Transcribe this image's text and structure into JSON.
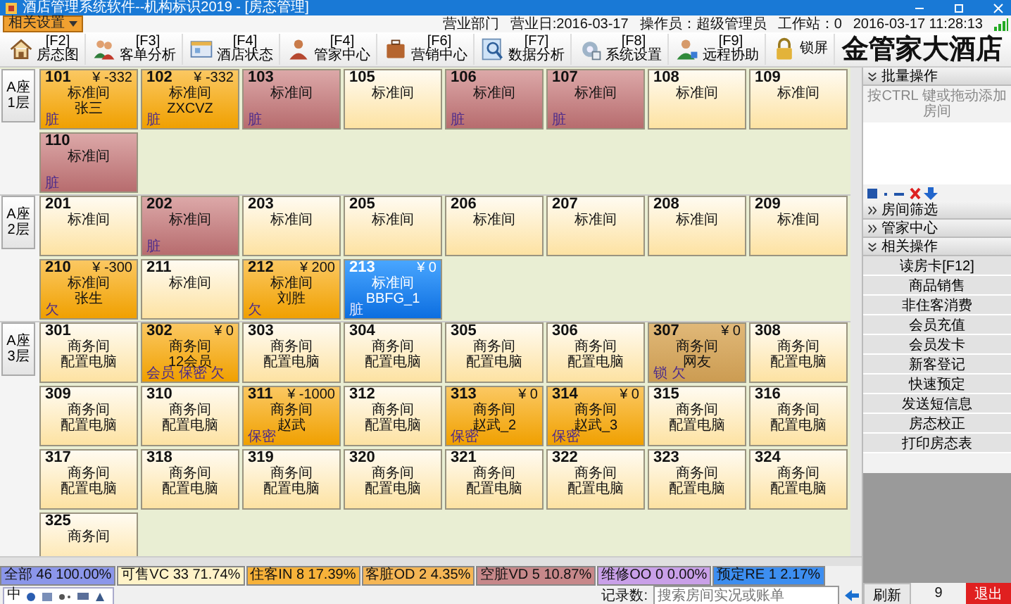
{
  "window": {
    "title": "酒店管理系统软件--机构标识2019 - [房态管理]"
  },
  "menu": {
    "label": "相关设置"
  },
  "header_info": [
    "营业部门",
    "营业日:2016-03-17",
    "操作员：超级管理员",
    "工作站：0",
    "2016-03-17 11:28:13"
  ],
  "toolbar": [
    {
      "key": "[F2]",
      "label": "房态图"
    },
    {
      "key": "[F3]",
      "label": "客单分析"
    },
    {
      "key": "[F4]",
      "label": "酒店状态"
    },
    {
      "key": "[F4]",
      "label": "管家中心"
    },
    {
      "key": "[F6]",
      "label": "营销中心"
    },
    {
      "key": "[F7]",
      "label": "数据分析"
    },
    {
      "key": "[F8]",
      "label": "系统设置"
    },
    {
      "key": "[F9]",
      "label": "远程协助"
    },
    {
      "label": "锁屏"
    }
  ],
  "logo": "金管家大酒店",
  "floors": [
    {
      "label": "A座 1层",
      "rows": [
        [
          {
            "number": "101",
            "price": "¥ -332",
            "type": "标准间",
            "detail": "张三",
            "tag": "脏",
            "kind": "occupied"
          },
          {
            "number": "102",
            "price": "¥ -332",
            "type": "标准间",
            "detail": "ZXCVZ",
            "tag": "脏",
            "kind": "occupied"
          },
          {
            "number": "103",
            "type": "标准间",
            "tag": "脏",
            "kind": "dirty"
          },
          {
            "number": "105",
            "type": "标准间",
            "kind": "vacant"
          },
          {
            "number": "106",
            "type": "标准间",
            "tag": "脏",
            "kind": "dirty"
          },
          {
            "number": "107",
            "type": "标准间",
            "tag": "脏",
            "kind": "dirty"
          },
          {
            "number": "108",
            "type": "标准间",
            "kind": "vacant"
          },
          {
            "number": "109",
            "type": "标准间",
            "kind": "vacant"
          }
        ],
        [
          {
            "number": "110",
            "type": "标准间",
            "tag": "脏",
            "kind": "dirty"
          }
        ]
      ]
    },
    {
      "label": "A座 2层",
      "rows": [
        [
          {
            "number": "201",
            "type": "标准间",
            "kind": "vacant"
          },
          {
            "number": "202",
            "type": "标准间",
            "tag": "脏",
            "kind": "dirty"
          },
          {
            "number": "203",
            "type": "标准间",
            "kind": "vacant"
          },
          {
            "number": "205",
            "type": "标准间",
            "kind": "vacant"
          },
          {
            "number": "206",
            "type": "标准间",
            "kind": "vacant"
          },
          {
            "number": "207",
            "type": "标准间",
            "kind": "vacant"
          },
          {
            "number": "208",
            "type": "标准间",
            "kind": "vacant"
          },
          {
            "number": "209",
            "type": "标准间",
            "kind": "vacant"
          }
        ],
        [
          {
            "number": "210",
            "price": "¥ -300",
            "type": "标准间",
            "detail": "张生",
            "tag": "欠",
            "kind": "occupied"
          },
          {
            "number": "211",
            "type": "标准间",
            "kind": "vacant"
          },
          {
            "number": "212",
            "price": "¥ 200",
            "type": "标准间",
            "detail": "刘胜",
            "tag": "欠",
            "kind": "occupied"
          },
          {
            "number": "213",
            "price": "¥ 0",
            "type": "标准间",
            "detail": "BBFG_1",
            "tag": "脏",
            "kind": "reserved"
          }
        ]
      ]
    },
    {
      "label": "A座 3层",
      "rows": [
        [
          {
            "number": "301",
            "type": "商务间",
            "detail": "配置电脑",
            "kind": "vacant"
          },
          {
            "number": "302",
            "price": "¥ 0",
            "type": "商务间",
            "detail": "12会员",
            "tag": "会员 保密 欠",
            "kind": "occupied"
          },
          {
            "number": "303",
            "type": "商务间",
            "detail": "配置电脑",
            "kind": "vacant"
          },
          {
            "number": "304",
            "type": "商务间",
            "detail": "配置电脑",
            "kind": "vacant"
          },
          {
            "number": "305",
            "type": "商务间",
            "detail": "配置电脑",
            "kind": "vacant"
          },
          {
            "number": "306",
            "type": "商务间",
            "detail": "配置电脑",
            "kind": "vacant"
          },
          {
            "number": "307",
            "price": "¥ 0",
            "type": "商务间",
            "detail": "网友",
            "tag": "锁 欠",
            "kind": "locked"
          },
          {
            "number": "308",
            "type": "商务间",
            "detail": "配置电脑",
            "kind": "vacant"
          }
        ],
        [
          {
            "number": "309",
            "type": "商务间",
            "detail": "配置电脑",
            "kind": "vacant"
          },
          {
            "number": "310",
            "type": "商务间",
            "detail": "配置电脑",
            "kind": "vacant"
          },
          {
            "number": "311",
            "price": "¥ -1000",
            "type": "商务间",
            "detail": "赵武",
            "tag": "保密",
            "kind": "occupied"
          },
          {
            "number": "312",
            "type": "商务间",
            "detail": "配置电脑",
            "kind": "vacant"
          },
          {
            "number": "313",
            "price": "¥ 0",
            "type": "商务间",
            "detail": "赵武_2",
            "tag": "保密",
            "kind": "occupied"
          },
          {
            "number": "314",
            "price": "¥ 0",
            "type": "商务间",
            "detail": "赵武_3",
            "tag": "保密",
            "kind": "occupied"
          },
          {
            "number": "315",
            "type": "商务间",
            "detail": "配置电脑",
            "kind": "vacant"
          },
          {
            "number": "316",
            "type": "商务间",
            "detail": "配置电脑",
            "kind": "vacant"
          }
        ],
        [
          {
            "number": "317",
            "type": "商务间",
            "detail": "配置电脑",
            "kind": "vacant"
          },
          {
            "number": "318",
            "type": "商务间",
            "detail": "配置电脑",
            "kind": "vacant"
          },
          {
            "number": "319",
            "type": "商务间",
            "detail": "配置电脑",
            "kind": "vacant"
          },
          {
            "number": "320",
            "type": "商务间",
            "detail": "配置电脑",
            "kind": "vacant"
          },
          {
            "number": "321",
            "type": "商务间",
            "detail": "配置电脑",
            "kind": "vacant"
          },
          {
            "number": "322",
            "type": "商务间",
            "detail": "配置电脑",
            "kind": "vacant"
          },
          {
            "number": "323",
            "type": "商务间",
            "detail": "配置电脑",
            "kind": "vacant"
          },
          {
            "number": "324",
            "type": "商务间",
            "detail": "配置电脑",
            "kind": "vacant"
          }
        ],
        [
          {
            "number": "325",
            "type": "商务间",
            "kind": "vacant"
          }
        ]
      ]
    }
  ],
  "status_bar": {
    "counts": [
      {
        "label": "全部 46 100.00%",
        "color": "#8b96ea"
      },
      {
        "label": "可售VC 33 71.74%",
        "color": "#fff3c8"
      },
      {
        "label": "住客IN 8 17.39%",
        "color": "#f7b23a"
      },
      {
        "label": "客脏OD 2 4.35%",
        "color": "#f5b655"
      },
      {
        "label": "空脏VD 5 10.87%",
        "color": "#c7888a"
      },
      {
        "label": "维修OO 0 0.00%",
        "color": "#c9a0e8"
      },
      {
        "label": "预定RE 1 2.17%",
        "color": "#3d8ef0"
      }
    ],
    "ime_mode": "中",
    "records_label": "记录数:",
    "search": {
      "placeholder": "搜索房间实况或账单"
    }
  },
  "side_panel": {
    "sections": [
      {
        "title": "批量操作",
        "expanded": true,
        "hint": "按CTRL 键或拖动添加房间"
      },
      {
        "title": "房间筛选",
        "expanded": false
      },
      {
        "title": "管家中心",
        "expanded": false
      },
      {
        "title": "相关操作",
        "expanded": true,
        "buttons": [
          "读房卡[F12]",
          "商品销售",
          "非住客消费",
          "会员充值",
          "会员发卡",
          "新客登记",
          "快速预定",
          "发送短信息",
          "房态校正",
          "打印房态表"
        ]
      }
    ],
    "refresh": "刷新",
    "count": "9",
    "exit": "退出"
  }
}
